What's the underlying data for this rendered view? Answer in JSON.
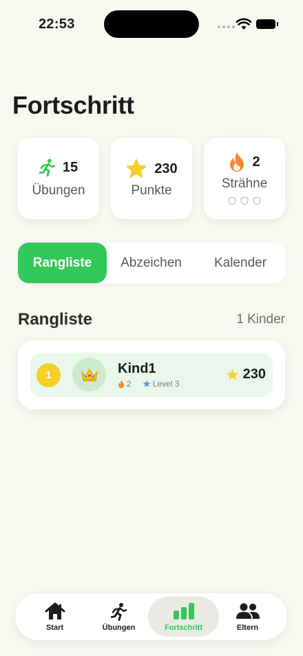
{
  "status_bar": {
    "time": "22:53"
  },
  "page": {
    "title": "Fortschritt"
  },
  "stats": [
    {
      "icon": "running-figure-icon",
      "value": "15",
      "label": "Übungen"
    },
    {
      "icon": "star-icon",
      "value": "230",
      "label": "Punkte"
    },
    {
      "icon": "flame-icon",
      "value": "2",
      "label": "Strähne"
    }
  ],
  "segments": [
    "Rangliste",
    "Abzeichen",
    "Kalender"
  ],
  "leaderboard": {
    "title": "Rangliste",
    "count": "1 Kinder",
    "entries": [
      {
        "rank": "1",
        "avatar": "crown-icon",
        "name": "Kind1",
        "streak": "2",
        "level": "Level 3",
        "points": "230"
      }
    ]
  },
  "tabs": [
    {
      "icon": "house-icon",
      "label": "Start"
    },
    {
      "icon": "running-figure-icon",
      "label": "Übungen"
    },
    {
      "icon": "bar-chart-icon",
      "label": "Fortschritt"
    },
    {
      "icon": "people-icon",
      "label": "Eltern"
    }
  ],
  "colors": {
    "accent": "#34c759",
    "background": "#f8f7f0",
    "rank_gold": "#f7cf2a",
    "row_highlight": "#eaf7ec"
  }
}
